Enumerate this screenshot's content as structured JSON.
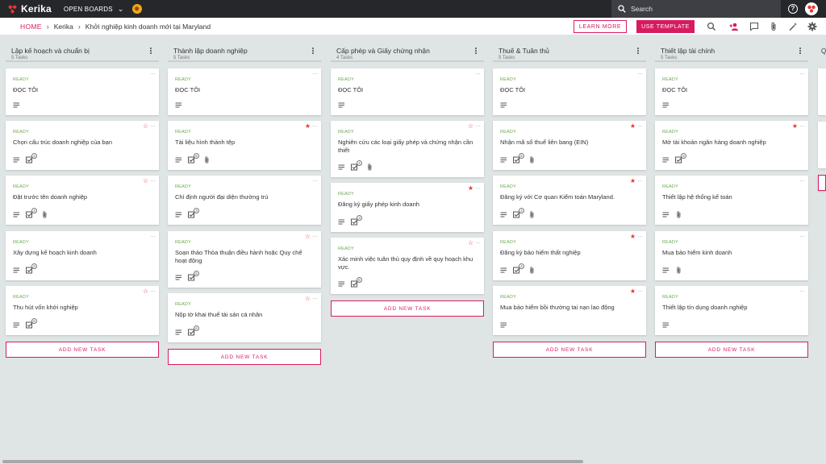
{
  "app": {
    "logo_text": "Kerika",
    "boards_label": "OPEN BOARDS",
    "search_placeholder": "Search"
  },
  "breadcrumb": {
    "home": "HOME",
    "team": "Kerika",
    "board": "Khởi nghiệp kinh doanh mới tại Maryland"
  },
  "actions": {
    "learn_more": "LEARN MORE",
    "use_template": "USE TEMPLATE"
  },
  "colors": {
    "accent": "#d81b60",
    "ready": "#6aa84f",
    "topbar": "#26272b",
    "board_bg": "#dfe5e4"
  },
  "add_task_label": "ADD NEW TASK",
  "columns": [
    {
      "title": "Lập kế hoạch và chuẩn bị",
      "count": "5 Tasks",
      "cards": [
        {
          "status": "READY",
          "title": "ĐỌC TÔI",
          "star": "none",
          "icons": [
            "notes"
          ]
        },
        {
          "status": "READY",
          "title": "Chọn cấu trúc doanh nghiệp của bạn",
          "star": "outline",
          "icons": [
            "notes",
            "checklist"
          ],
          "check_count": "4"
        },
        {
          "status": "READY",
          "title": "Đặt trước tên doanh nghiệp",
          "star": "outline",
          "icons": [
            "notes",
            "checklist",
            "attachment"
          ],
          "check_count": "4"
        },
        {
          "status": "READY",
          "title": "Xây dựng kế hoạch kinh doanh",
          "star": "none",
          "icons": [
            "notes",
            "checklist"
          ],
          "check_count": "3"
        },
        {
          "status": "READY",
          "title": "Thu hút vốn khởi nghiệp",
          "star": "outline",
          "icons": [
            "notes",
            "checklist"
          ],
          "check_count": "5"
        }
      ]
    },
    {
      "title": "Thành lập doanh nghiệp",
      "count": "5 Tasks",
      "cards": [
        {
          "status": "READY",
          "title": "ĐỌC TÔI",
          "star": "none",
          "icons": [
            "notes"
          ]
        },
        {
          "status": "READY",
          "title": "Tài liệu hình thành tệp",
          "star": "filled",
          "icons": [
            "notes",
            "checklist",
            "attachment"
          ],
          "check_count": "5"
        },
        {
          "status": "READY",
          "title": "Chỉ định người đại diện thường trú",
          "star": "none",
          "icons": [
            "notes",
            "checklist"
          ],
          "check_count": "4"
        },
        {
          "status": "READY",
          "title": "Soạn thảo Thỏa thuận điều hành hoặc Quy chế hoạt động",
          "star": "outline",
          "icons": [
            "notes",
            "checklist"
          ],
          "check_count": "5"
        },
        {
          "status": "READY",
          "title": "Nộp tờ khai thuế tài sản cá nhân",
          "star": "outline",
          "icons": [
            "notes",
            "checklist"
          ],
          "check_count": "6"
        }
      ]
    },
    {
      "title": "Cấp phép và Giấy chứng nhận",
      "count": "4 Tasks",
      "cards": [
        {
          "status": "READY",
          "title": "ĐỌC TÔI",
          "star": "none",
          "icons": [
            "notes"
          ]
        },
        {
          "status": "READY",
          "title": "Nghiên cứu các loại giấy phép và chứng nhận cần thiết",
          "star": "outline",
          "icons": [
            "notes",
            "checklist",
            "attachment"
          ],
          "check_count": "4"
        },
        {
          "status": "READY",
          "title": "Đăng ký giấy phép kinh doanh",
          "star": "filled",
          "icons": [
            "notes",
            "checklist"
          ],
          "check_count": "3"
        },
        {
          "status": "READY",
          "title": "Xác minh việc tuân thủ quy định về quy hoạch khu vực.",
          "star": "outline",
          "icons": [
            "notes",
            "checklist"
          ],
          "check_count": "5"
        }
      ]
    },
    {
      "title": "Thuế & Tuân thủ",
      "count": "5 Tasks",
      "cards": [
        {
          "status": "READY",
          "title": "ĐỌC TÔI",
          "star": "none",
          "icons": [
            "notes"
          ]
        },
        {
          "status": "READY",
          "title": "Nhận mã số thuế liên bang (EIN)",
          "star": "filled",
          "icons": [
            "notes",
            "checklist",
            "attachment"
          ],
          "check_count": "5"
        },
        {
          "status": "READY",
          "title": "Đăng ký với Cơ quan Kiểm toán Maryland.",
          "star": "filled",
          "icons": [
            "notes",
            "checklist",
            "attachment"
          ],
          "check_count": "4"
        },
        {
          "status": "READY",
          "title": "Đăng ký bảo hiểm thất nghiệp",
          "star": "filled",
          "icons": [
            "notes",
            "checklist",
            "attachment"
          ],
          "check_count": "4"
        },
        {
          "status": "READY",
          "title": "Mua bảo hiểm bồi thường tai nạn lao động",
          "star": "filled",
          "icons": [
            "notes"
          ]
        }
      ]
    },
    {
      "title": "Thiết lập tài chính",
      "count": "5 Tasks",
      "cards": [
        {
          "status": "READY",
          "title": "ĐỌC TÔI",
          "star": "none",
          "icons": [
            "notes"
          ]
        },
        {
          "status": "READY",
          "title": "Mở tài khoản ngân hàng doanh nghiệp",
          "star": "filled",
          "icons": [
            "notes",
            "checklist"
          ],
          "check_count": "5"
        },
        {
          "status": "READY",
          "title": "Thiết lập hệ thống kế toán",
          "star": "none",
          "icons": [
            "notes",
            "attachment"
          ]
        },
        {
          "status": "READY",
          "title": "Mua bảo hiểm kinh doanh",
          "star": "none",
          "icons": [
            "notes",
            "attachment"
          ]
        },
        {
          "status": "READY",
          "title": "Thiết lập tín dụng doanh nghiệp",
          "star": "none",
          "icons": [
            "notes"
          ]
        }
      ]
    }
  ]
}
